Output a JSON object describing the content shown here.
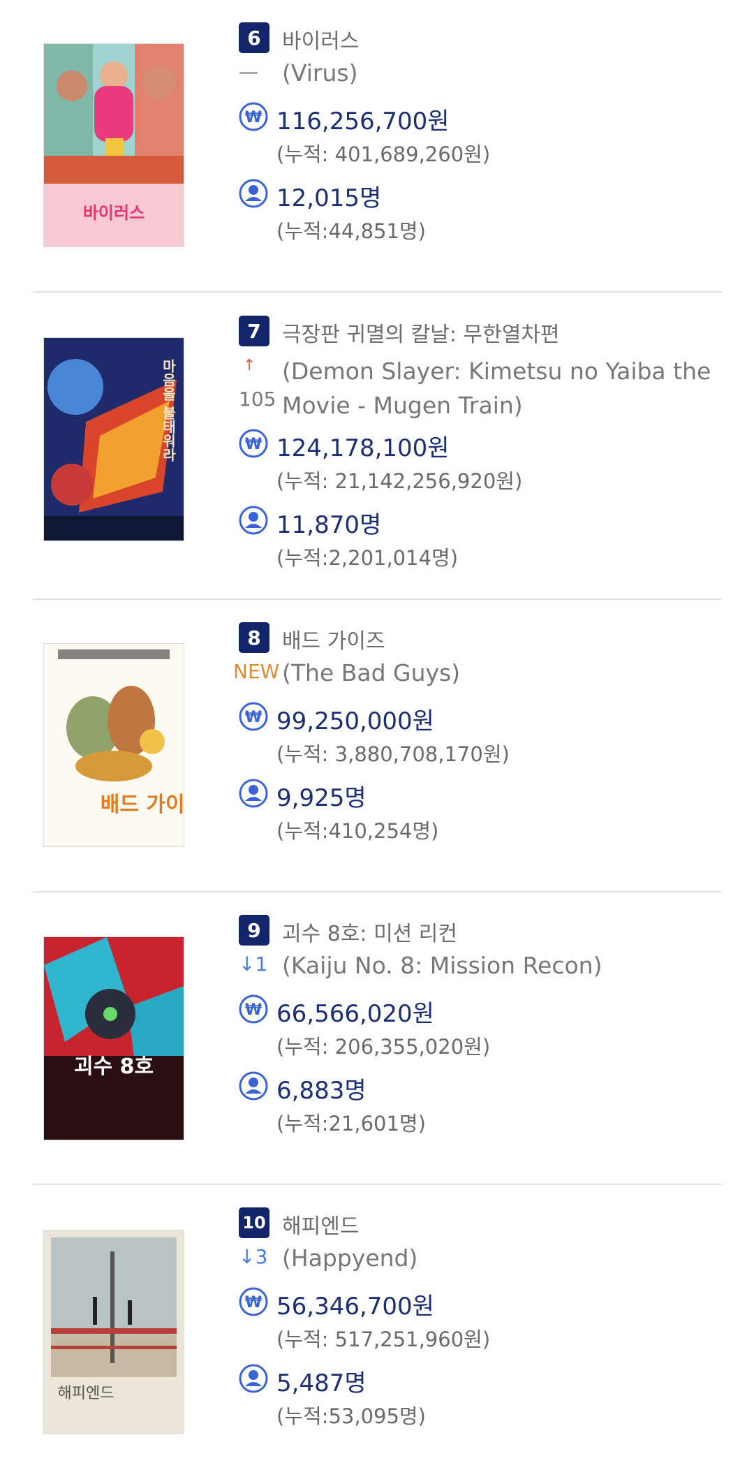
{
  "colors": {
    "badge": "#13256a",
    "value": "#1b2e73",
    "new": "#e08a2c",
    "up": "#ee5a45",
    "down": "#4a7be0",
    "icon": "#3b63d8"
  },
  "entries": [
    {
      "rank": "6",
      "title_ko": "바이러스",
      "change": "—",
      "title_en": "(Virus)",
      "sales": "116,256,700원",
      "sales_total": "(누적: 401,689,260원)",
      "audience": "12,015명",
      "audience_total": "(누적:44,851명)",
      "poster_text": "바이러스"
    },
    {
      "rank": "7",
      "title_ko": "극장판 귀멸의 칼날: 무한열차편",
      "change_arrow": "↑",
      "change": "105",
      "title_en": "(Demon Slayer: Kimetsu no Yaiba the Movie - Mugen Train)",
      "sales": "124,178,100원",
      "sales_total": "(누적: 21,142,256,920원)",
      "audience": "11,870명",
      "audience_total": "(누적:2,201,014명)",
      "poster_text": "마음을 불태워라"
    },
    {
      "rank": "8",
      "title_ko": "배드 가이즈",
      "change": "NEW",
      "title_en": "(The Bad Guys)",
      "sales": "99,250,000원",
      "sales_total": "(누적: 3,880,708,170원)",
      "audience": "9,925명",
      "audience_total": "(누적:410,254명)",
      "poster_text": "배드 가이즈"
    },
    {
      "rank": "9",
      "title_ko": "괴수 8호: 미션 리컨",
      "change": "↓1",
      "title_en": "(Kaiju No. 8: Mission Recon)",
      "sales": "66,566,020원",
      "sales_total": "(누적: 206,355,020원)",
      "audience": "6,883명",
      "audience_total": "(누적:21,601명)",
      "poster_text": "괴수 8호"
    },
    {
      "rank": "10",
      "title_ko": "해피엔드",
      "change": "↓3",
      "title_en": "(Happyend)",
      "sales": "56,346,700원",
      "sales_total": "(누적: 517,251,960원)",
      "audience": "5,487명",
      "audience_total": "(누적:53,095명)",
      "poster_text": "해피엔드"
    }
  ],
  "icons": {
    "sales": "won-icon",
    "audience": "person-icon"
  }
}
